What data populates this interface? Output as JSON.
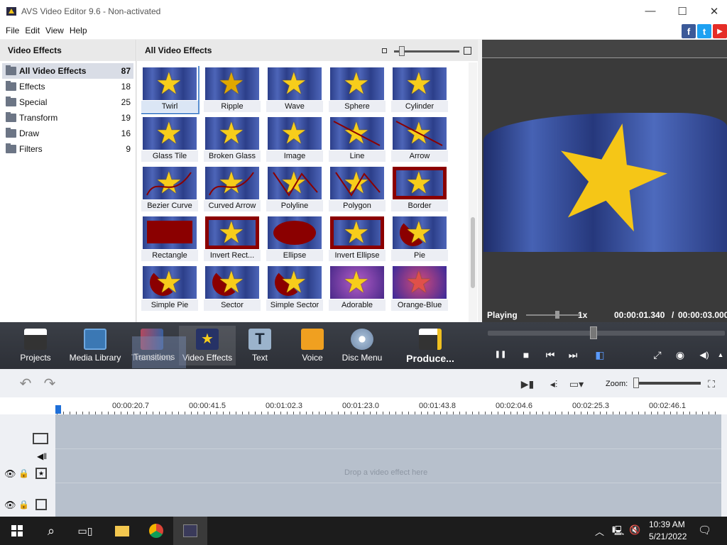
{
  "window": {
    "title": "AVS Video Editor 9.6 - Non-activated",
    "minimize": "—",
    "maximize": "☐",
    "close": "✕"
  },
  "menu": [
    "File",
    "Edit",
    "View",
    "Help"
  ],
  "social": {
    "facebook": "f",
    "twitter": "t",
    "youtube": "▶"
  },
  "left_panel": {
    "heading": "Video Effects",
    "categories": [
      {
        "label": "All Video Effects",
        "count": "87",
        "selected": true
      },
      {
        "label": "Effects",
        "count": "18"
      },
      {
        "label": "Special",
        "count": "25"
      },
      {
        "label": "Transform",
        "count": "19"
      },
      {
        "label": "Draw",
        "count": "16"
      },
      {
        "label": "Filters",
        "count": "9"
      }
    ]
  },
  "center_panel": {
    "heading": "All Video Effects",
    "effects": [
      "Twirl",
      "Ripple",
      "Wave",
      "Sphere",
      "Cylinder",
      "Glass Tile",
      "Broken Glass",
      "Image",
      "Line",
      "Arrow",
      "Bezier Curve",
      "Curved Arrow",
      "Polyline",
      "Polygon",
      "Border",
      "Rectangle",
      "Invert Rect...",
      "Ellipse",
      "Invert Ellipse",
      "Pie",
      "Simple Pie",
      "Sector",
      "Simple Sector",
      "Adorable",
      "Orange-Blue"
    ],
    "selected_effect": "Twirl"
  },
  "preview": {
    "status": "Playing",
    "speed": "1x",
    "current_time": "00:00:01.340",
    "separator": "/",
    "total_time": "00:00:03.000"
  },
  "toolbar": {
    "buttons": [
      {
        "label": "Projects",
        "icon": "clapperboard-icon"
      },
      {
        "label": "Media Library",
        "icon": "film-icon"
      },
      {
        "label": "Transitions",
        "icon": "transition-icon"
      },
      {
        "label": "Video Effects",
        "icon": "star-effect-icon"
      },
      {
        "label": "Text",
        "icon": "text-icon"
      },
      {
        "label": "Voice",
        "icon": "microphone-icon"
      },
      {
        "label": "Disc Menu",
        "icon": "disc-icon"
      },
      {
        "label": "Produce...",
        "icon": "produce-icon"
      }
    ],
    "active": "Video Effects",
    "drag_ghost_label": "Transitions"
  },
  "playback": {
    "pause": "❚❚",
    "stop": "■",
    "prev": "⏮",
    "next": "⏭",
    "snapshot": "◉",
    "volume": "◀)"
  },
  "timeline": {
    "zoom_label": "Zoom:",
    "ruler": [
      "00:00:20.7",
      "00:00:41.5",
      "00:01:02.3",
      "00:01:23.0",
      "00:01:43.8",
      "00:02:04.6",
      "00:02:25.3",
      "00:02:46.1"
    ],
    "drop_hint": "Drop a video effect here"
  },
  "taskbar": {
    "time": "10:39 AM",
    "date": "5/21/2022"
  },
  "colors": {
    "toolbar_bg": "#2d3037",
    "selection": "#5a8fd0",
    "star": "#f7cd1b",
    "timeline_track": "#b7c0cc"
  }
}
